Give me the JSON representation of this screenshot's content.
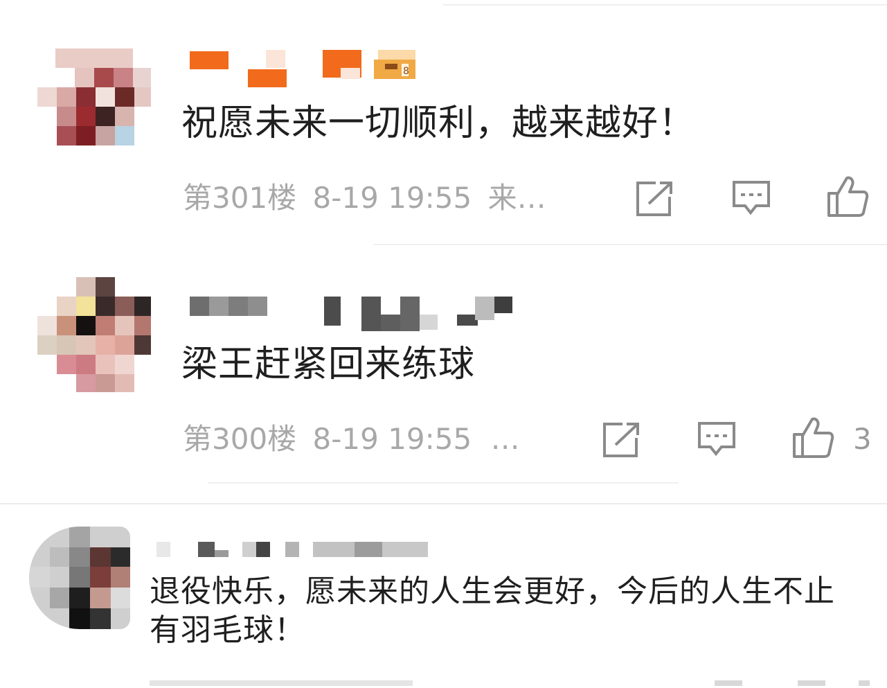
{
  "comments": [
    {
      "text": "祝愿未来一切顺利，越来越好！",
      "floor": "第301楼",
      "datetime": "8-19 19:55",
      "source": "来…",
      "like_count": ""
    },
    {
      "text": "梁王赶紧回来练球",
      "floor": "第300楼",
      "datetime": "8-19 19:55",
      "source": "…",
      "like_count": "3"
    },
    {
      "text_line1": "退役快乐，愿未来的人生会更好，今后的人生不止",
      "text_line2": "有羽毛球！"
    }
  ],
  "icons": {
    "forward": "share-arrow-icon",
    "comment": "comment-bubble-icon",
    "like": "thumbs-up-icon"
  },
  "colors": {
    "meta_text": "#a8a8a8",
    "icon_stroke": "#8a8a8a",
    "name_orange": "#f26a1b",
    "divider": "#efefef"
  }
}
